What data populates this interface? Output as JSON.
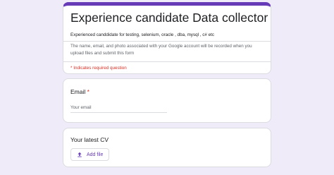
{
  "header": {
    "title": "Experience candidate Data collector",
    "description": "Experienced canddidate for testing, selenium, oracle , dba, mysql , c# etc",
    "account_notice": "The name, email, and photo associated with your Google account will be recorded when you upload files and submit this form",
    "required_note": "* Indicates required question"
  },
  "questions": {
    "email": {
      "title": "Email",
      "required_marker": "*",
      "placeholder": "Your email"
    },
    "cv": {
      "title": "Your latest CV",
      "add_file_label": "Add file"
    }
  },
  "colors": {
    "accent": "#673ab7",
    "background": "#f0ebf8",
    "required": "#d93025"
  },
  "icons": {
    "add_file": "upload-icon"
  }
}
